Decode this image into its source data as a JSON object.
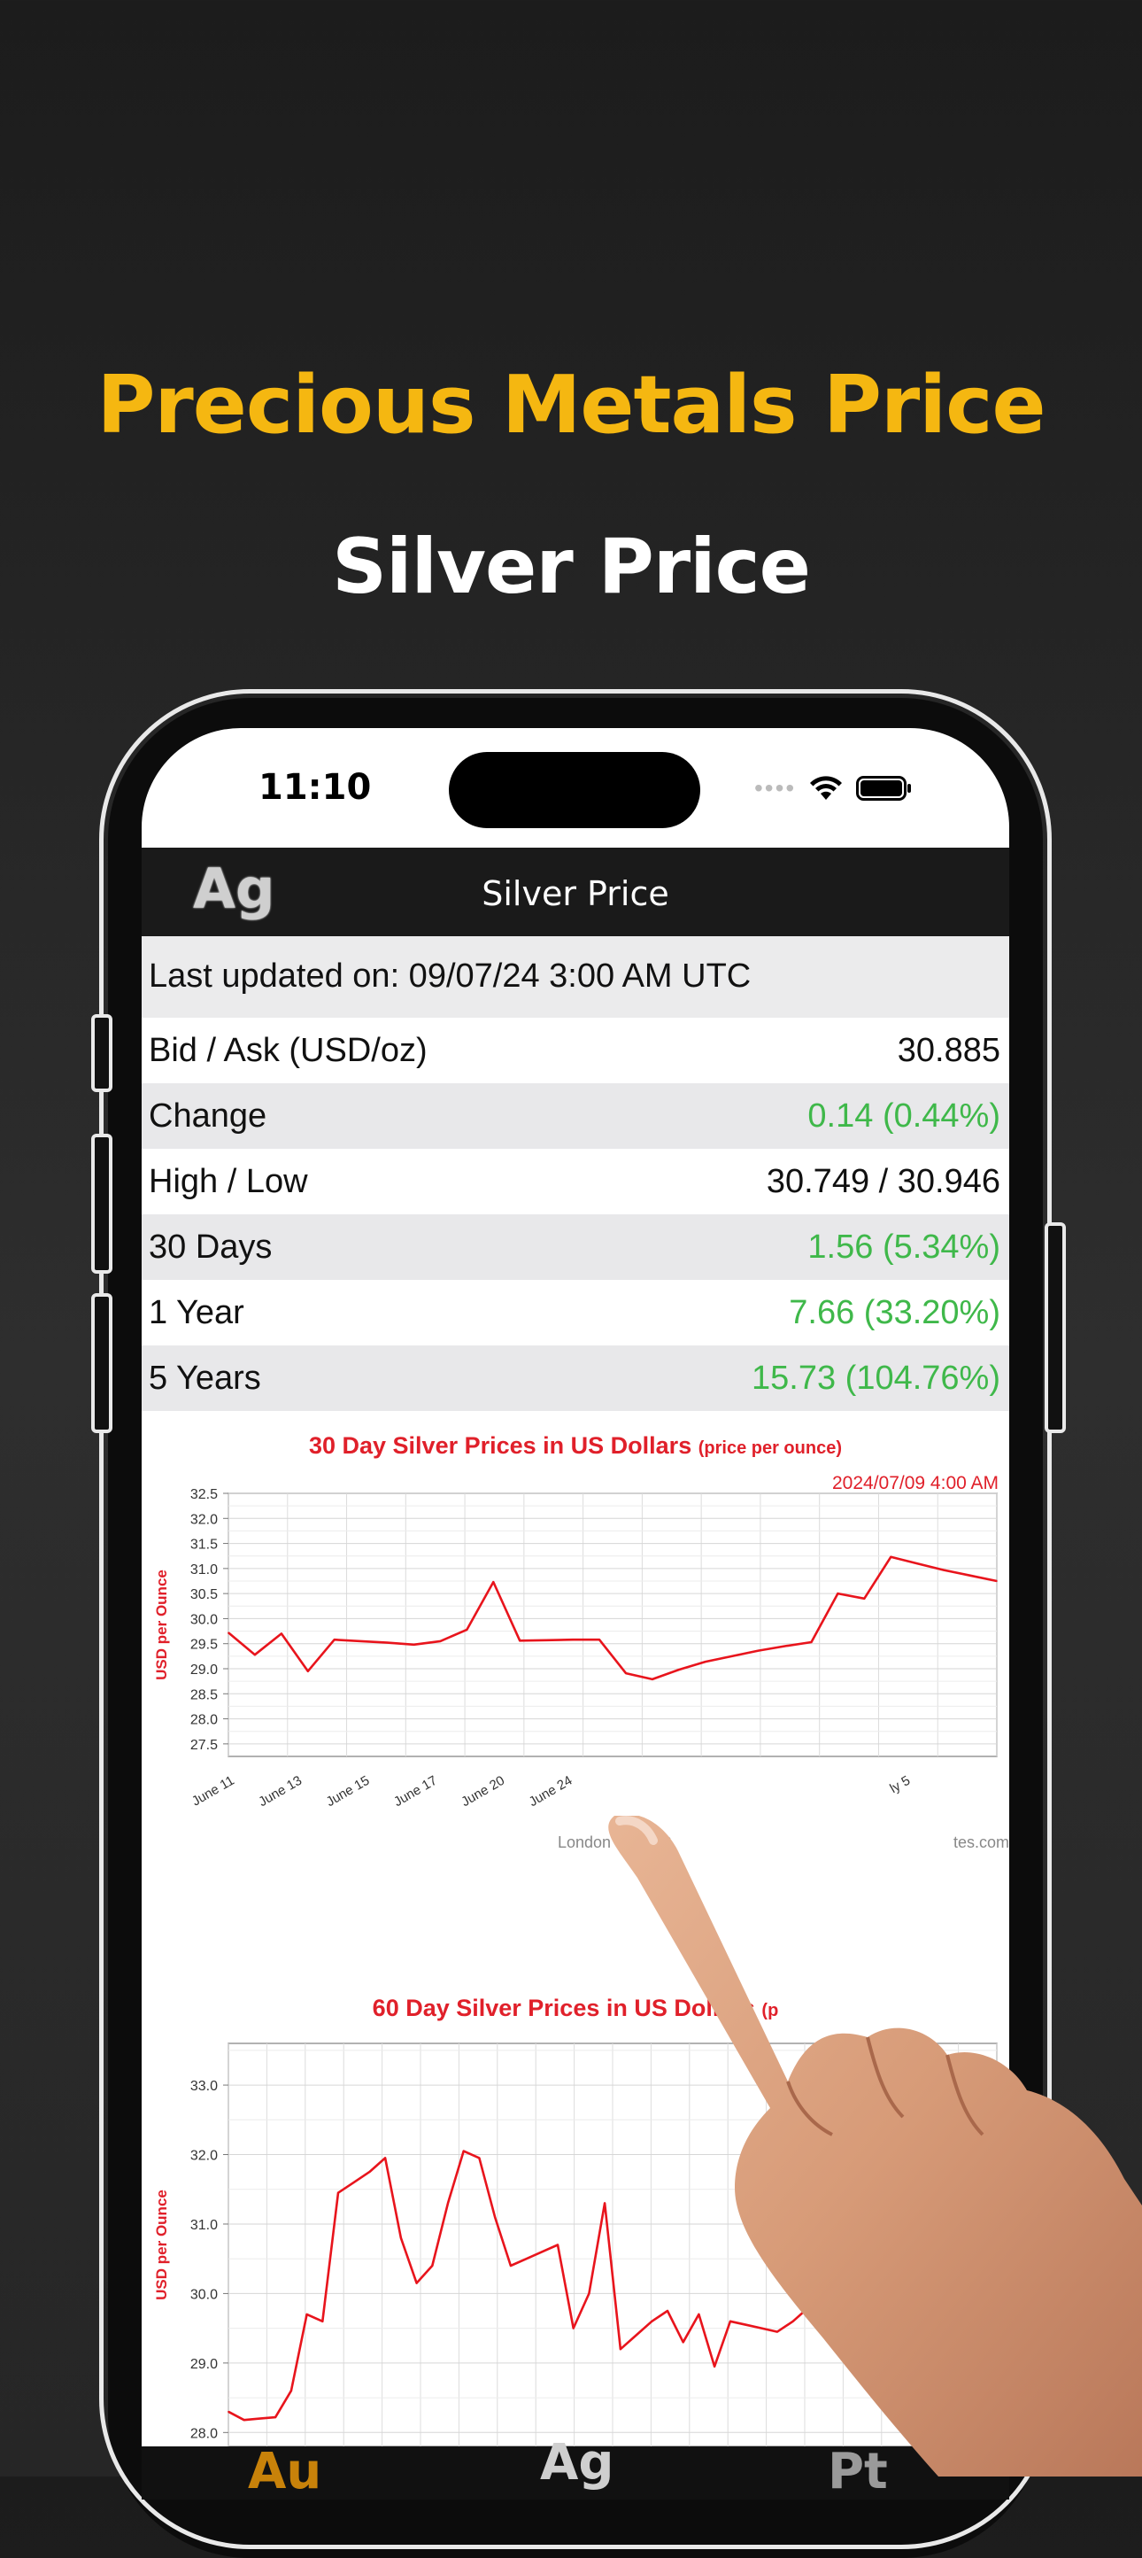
{
  "promo": {
    "headline": "Precious Metals Price",
    "subheadline": "Silver Price"
  },
  "status_bar": {
    "time": "11:10"
  },
  "navbar": {
    "logo": "Ag",
    "title": "Silver Price"
  },
  "last_updated": "Last updated on: 09/07/24 3:00 AM UTC",
  "rows": [
    {
      "label": "Bid / Ask (USD/oz)",
      "value": "30.885",
      "positive": false
    },
    {
      "label": "Change",
      "value": "0.14 (0.44%)",
      "positive": true
    },
    {
      "label": "High / Low",
      "value": "30.749 / 30.946",
      "positive": false
    },
    {
      "label": "30 Days",
      "value": "1.56 (5.34%)",
      "positive": true
    },
    {
      "label": "1 Year",
      "value": "7.66 (33.20%)",
      "positive": true
    },
    {
      "label": "5 Years",
      "value": "15.73 (104.76%)",
      "positive": true
    }
  ],
  "chart_data": [
    {
      "type": "line",
      "title": "30 Day Silver Prices in US Dollars",
      "title_suffix": "(price per ounce)",
      "timestamp": "2024/07/09 4:00 AM",
      "ylabel": "USD per Ounce",
      "xlabel": "London Time (G",
      "source_fragment": "tes.com",
      "ylim": [
        27.25,
        32.5
      ],
      "yticks": [
        "27.5",
        "28.0",
        "28.5",
        "29.0",
        "29.5",
        "30.0",
        "30.5",
        "31.0",
        "31.5",
        "32.0",
        "32.5"
      ],
      "xticks": [
        "June 11",
        "June 13",
        "June 15",
        "June 17",
        "June 20",
        "June 24",
        "",
        "",
        "",
        "",
        "ly 5"
      ],
      "x": [
        0,
        1,
        2,
        3,
        4,
        5,
        6,
        7,
        8,
        9,
        10,
        11,
        12,
        13,
        14,
        15,
        16,
        17,
        18,
        19,
        20,
        21,
        22,
        23,
        24,
        25,
        26,
        27,
        28,
        29
      ],
      "values": [
        29.72,
        29.28,
        29.7,
        28.95,
        29.58,
        29.55,
        29.52,
        29.48,
        29.55,
        29.78,
        30.73,
        29.56,
        29.57,
        29.58,
        29.58,
        28.91,
        28.79,
        28.98,
        29.14,
        29.25,
        29.36,
        29.45,
        29.53,
        30.5,
        30.4,
        31.23,
        31.1,
        30.97,
        30.86,
        30.75
      ]
    },
    {
      "type": "line",
      "title": "60 Day Silver Prices in US Dollars",
      "title_suffix": "(p",
      "ylabel": "USD per Ounce",
      "ylim": [
        27.8,
        33.6
      ],
      "yticks": [
        "28.0",
        "29.0",
        "30.0",
        "31.0",
        "32.0",
        "33.0"
      ],
      "x": [
        0,
        1,
        2,
        3,
        4,
        5,
        6,
        7,
        8,
        9,
        10,
        11,
        12,
        13,
        14,
        15,
        16,
        17,
        18,
        19,
        20,
        21,
        22,
        23,
        24,
        25,
        26,
        27,
        28,
        29,
        30,
        31,
        32,
        33,
        34,
        35,
        36,
        37,
        38,
        39,
        40,
        41,
        42,
        43,
        44,
        45,
        46,
        47,
        48,
        49
      ],
      "values": [
        28.3,
        28.18,
        28.2,
        28.22,
        28.6,
        29.7,
        29.6,
        31.45,
        31.6,
        31.75,
        31.95,
        30.8,
        30.15,
        30.4,
        31.3,
        32.05,
        31.95,
        31.1,
        30.4,
        30.5,
        30.6,
        30.7,
        29.5,
        30.0,
        31.3,
        29.2,
        29.4,
        29.6,
        29.75,
        29.3,
        29.7,
        28.95,
        29.6,
        29.55,
        29.5,
        29.45,
        29.6,
        29.8,
        30.6,
        29.55,
        29.55,
        29.6,
        29.55,
        28.9,
        28.75,
        29.1,
        29.4,
        29.6,
        29.8,
        30.0
      ]
    }
  ],
  "bottom_tabs": [
    "Au",
    "Ag",
    "Pt"
  ],
  "colors": {
    "accent": "#F5B711",
    "positive": "#3fb84a",
    "chart_line": "#e0202a"
  },
  "icons": [
    "wifi-icon",
    "battery-icon",
    "pointing-hand"
  ]
}
